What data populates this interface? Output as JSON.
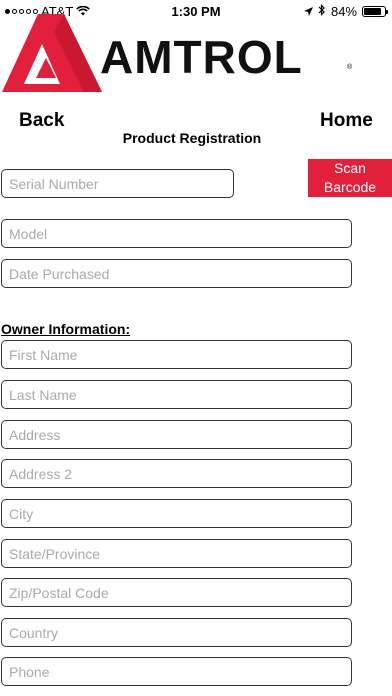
{
  "status_bar": {
    "carrier": "AT&T",
    "time": "1:30 PM",
    "battery": "84%",
    "battery_level": 0.84,
    "icons": [
      "signal-dots-icon",
      "wifi-icon",
      "location-arrow-icon",
      "bluetooth-icon",
      "battery-icon"
    ]
  },
  "logo": {
    "text": "AMTROL",
    "mark": "®",
    "brand_color": "#e3203b"
  },
  "nav": {
    "back": "Back",
    "home": "Home"
  },
  "title": "Product Registration",
  "scan_button": {
    "line1": "Scan",
    "line2": "Barcode",
    "color": "#e3203b"
  },
  "product_fields": {
    "serial": "Serial Number",
    "model": "Model",
    "date": "Date Purchased"
  },
  "owner": {
    "heading": "Owner Information:",
    "first_name": "First Name",
    "last_name": "Last Name",
    "address": "Address",
    "address2": "Address 2",
    "city": "City",
    "state": "State/Province",
    "zip": "Zip/Postal Code",
    "country": "Country",
    "phone": "Phone"
  }
}
